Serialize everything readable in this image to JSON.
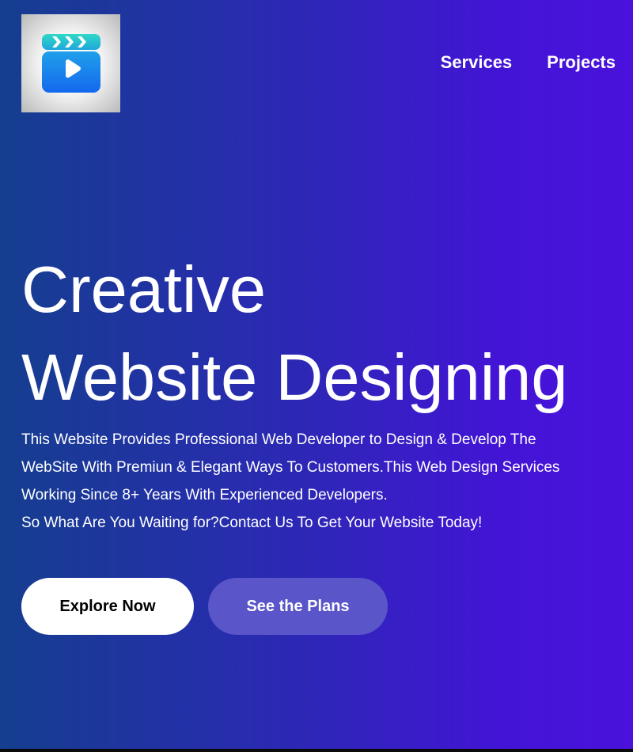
{
  "logo": {
    "icon": "video-play-clapper-icon"
  },
  "nav": {
    "items": [
      {
        "label": "Services"
      },
      {
        "label": "Projects"
      }
    ]
  },
  "hero": {
    "title_lines": [
      "Creative",
      "Website Designing"
    ],
    "description_lines": [
      "This Website Provides Professional Web Developer to Design & Develop The",
      "WebSite With Premiun & Elegant Ways To Customers.This Web Design Services",
      "Working Since 8+ Years With Experienced Developers.",
      "So What Are You Waiting for?Contact Us To Get Your Website Today!"
    ],
    "buttons": {
      "primary_label": "Explore Now",
      "secondary_label": "See the Plans"
    }
  },
  "colors": {
    "gradient_start": "#153e8f",
    "gradient_end": "#4a12dc",
    "secondary_button": "#5a56c9",
    "logo_icon_top": "#2fd3c4",
    "logo_icon_bottom": "#1478f0"
  }
}
